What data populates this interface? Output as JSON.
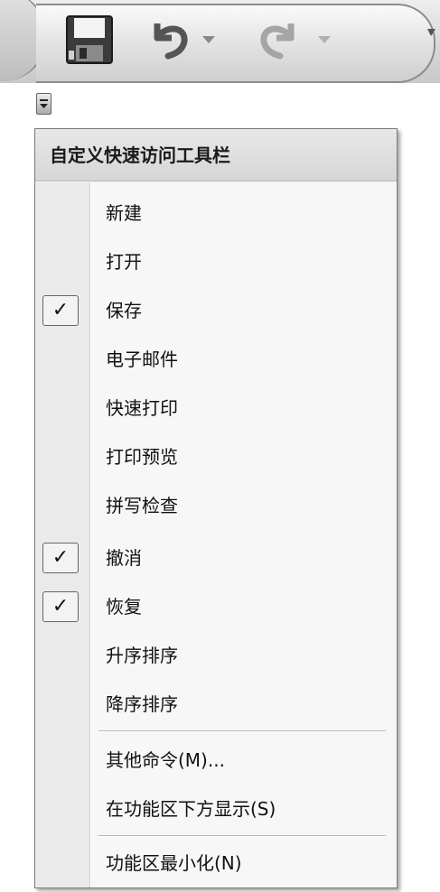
{
  "qat": {
    "icons": [
      "save-icon",
      "undo-icon",
      "dropdown-arrow-icon",
      "redo-icon",
      "dropdown-arrow-icon"
    ]
  },
  "menu": {
    "title": "自定义快速访问工具栏",
    "items": [
      {
        "label": "新建",
        "checked": false
      },
      {
        "label": "打开",
        "checked": false
      },
      {
        "label": "保存",
        "checked": true
      },
      {
        "label": "电子邮件",
        "checked": false
      },
      {
        "label": "快速打印",
        "checked": false
      },
      {
        "label": "打印预览",
        "checked": false
      },
      {
        "label": "拼写检查",
        "checked": false
      },
      {
        "label": "撤消",
        "checked": true
      },
      {
        "label": "恢复",
        "checked": true
      },
      {
        "label": "升序排序",
        "checked": false
      },
      {
        "label": "降序排序",
        "checked": false
      }
    ],
    "more_commands": "其他命令(M)...",
    "show_below": "在功能区下方显示(S)",
    "minimize_ribbon": "功能区最小化(N)",
    "check_mark": "✓"
  }
}
